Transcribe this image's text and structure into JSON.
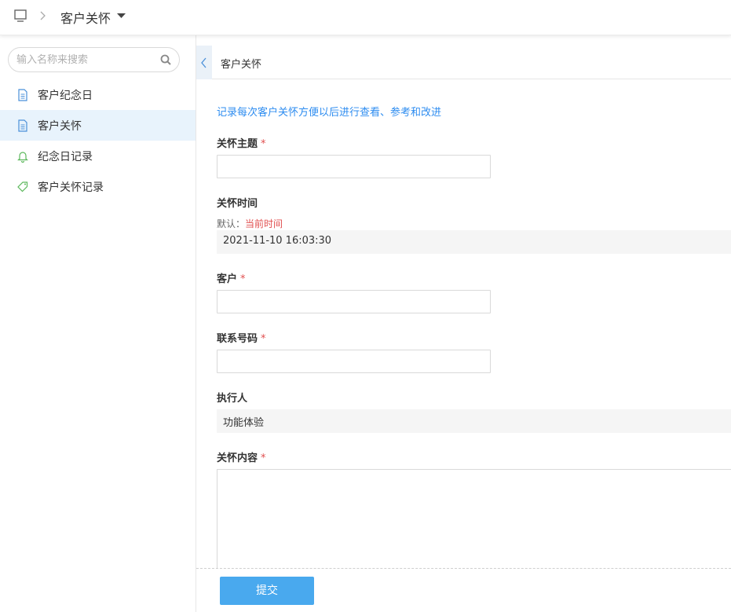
{
  "topbar": {
    "title": "客户关怀"
  },
  "sidebar": {
    "search_placeholder": "输入名称来搜索",
    "items": [
      {
        "label": "客户纪念日",
        "icon": "document-icon",
        "active": false
      },
      {
        "label": "客户关怀",
        "icon": "document-icon",
        "active": true
      },
      {
        "label": "纪念日记录",
        "icon": "bell-icon",
        "active": false
      },
      {
        "label": "客户关怀记录",
        "icon": "tag-icon",
        "active": false
      }
    ]
  },
  "panel": {
    "title": "客户关怀",
    "intro": "记录每次客户关怀方便以后进行查看、参考和改进"
  },
  "form": {
    "topic_label": "关怀主题",
    "time_label": "关怀时间",
    "time_hint_prefix": "默认：",
    "time_hint_value": "当前时间",
    "time_value": "2021-11-10 16:03:30",
    "customer_label": "客户",
    "phone_label": "联系号码",
    "executor_label": "执行人",
    "executor_value": "功能体验",
    "content_label": "关怀内容",
    "required_mark": "*",
    "submit_label": "提交"
  },
  "colors": {
    "accent": "#2d8cf0",
    "button": "#49a9ee",
    "required": "#e14f4f",
    "active_nav_bg": "#e8f3fc"
  }
}
